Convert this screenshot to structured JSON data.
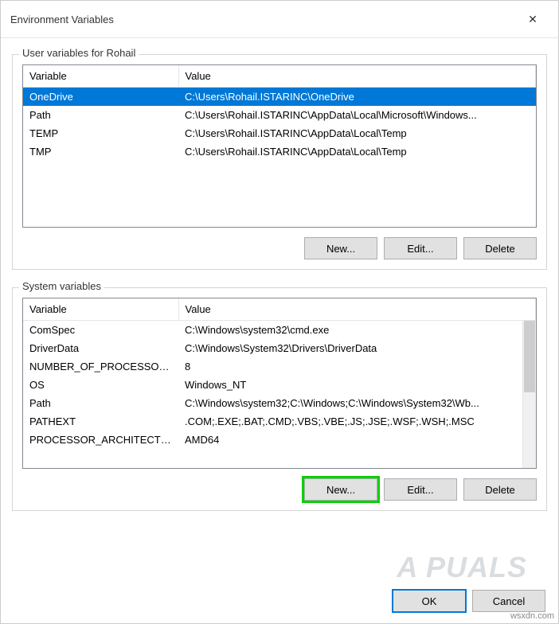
{
  "window": {
    "title": "Environment Variables",
    "close_label": "✕"
  },
  "user_vars": {
    "group_label": "User variables for Rohail",
    "columns": {
      "variable": "Variable",
      "value": "Value"
    },
    "rows": [
      {
        "variable": "OneDrive",
        "value": "C:\\Users\\Rohail.ISTARINC\\OneDrive",
        "selected": true
      },
      {
        "variable": "Path",
        "value": "C:\\Users\\Rohail.ISTARINC\\AppData\\Local\\Microsoft\\Windows..."
      },
      {
        "variable": "TEMP",
        "value": "C:\\Users\\Rohail.ISTARINC\\AppData\\Local\\Temp"
      },
      {
        "variable": "TMP",
        "value": "C:\\Users\\Rohail.ISTARINC\\AppData\\Local\\Temp"
      }
    ],
    "buttons": {
      "new": "New...",
      "edit": "Edit...",
      "delete": "Delete"
    }
  },
  "system_vars": {
    "group_label": "System variables",
    "columns": {
      "variable": "Variable",
      "value": "Value"
    },
    "rows": [
      {
        "variable": "ComSpec",
        "value": "C:\\Windows\\system32\\cmd.exe"
      },
      {
        "variable": "DriverData",
        "value": "C:\\Windows\\System32\\Drivers\\DriverData"
      },
      {
        "variable": "NUMBER_OF_PROCESSORS",
        "value": "8"
      },
      {
        "variable": "OS",
        "value": "Windows_NT"
      },
      {
        "variable": "Path",
        "value": "C:\\Windows\\system32;C:\\Windows;C:\\Windows\\System32\\Wb..."
      },
      {
        "variable": "PATHEXT",
        "value": ".COM;.EXE;.BAT;.CMD;.VBS;.VBE;.JS;.JSE;.WSF;.WSH;.MSC"
      },
      {
        "variable": "PROCESSOR_ARCHITECTU...",
        "value": "AMD64"
      }
    ],
    "buttons": {
      "new": "New...",
      "edit": "Edit...",
      "delete": "Delete"
    }
  },
  "dialog_buttons": {
    "ok": "OK",
    "cancel": "Cancel"
  },
  "watermark": "A  PUALS",
  "credit": "wsxdn.com"
}
